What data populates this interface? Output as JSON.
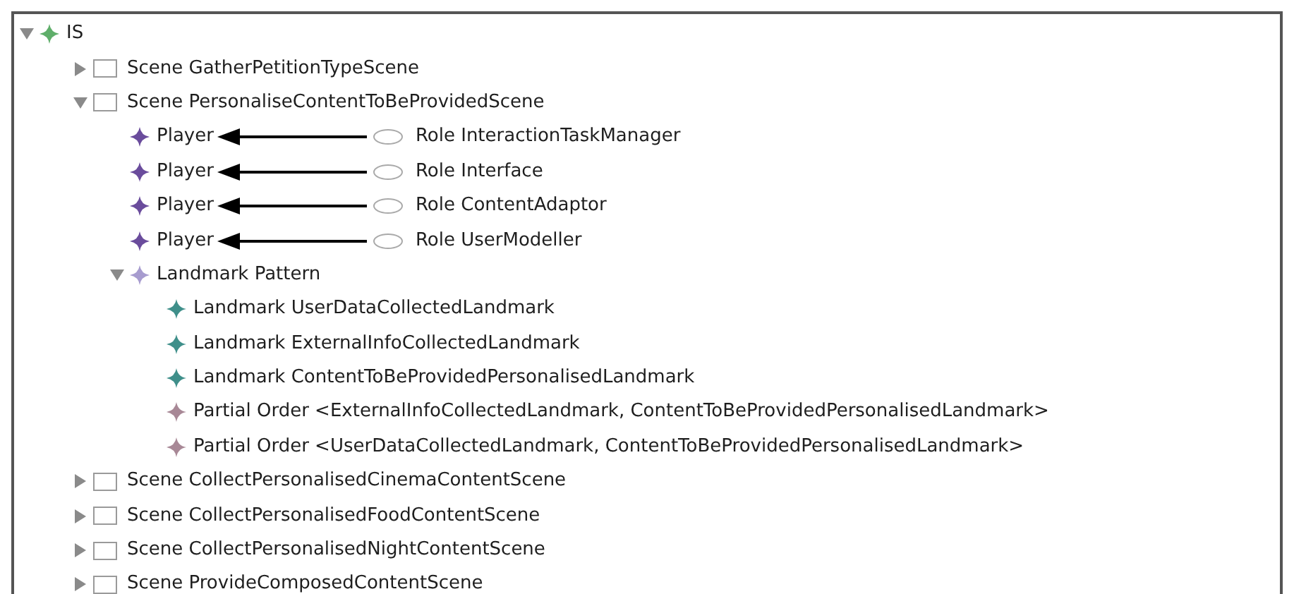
{
  "tree": {
    "label": "IS",
    "kind": "root",
    "expanded": true,
    "children": [
      {
        "label": "Scene GatherPetitionTypeScene",
        "kind": "scene",
        "expanded": false
      },
      {
        "label": "Scene PersonaliseContentToBeProvidedScene",
        "kind": "scene",
        "expanded": true,
        "children": [
          {
            "label": "Player",
            "kind": "player",
            "role": "Role InteractionTaskManager"
          },
          {
            "label": "Player",
            "kind": "player",
            "role": "Role Interface"
          },
          {
            "label": "Player",
            "kind": "player",
            "role": "Role ContentAdaptor"
          },
          {
            "label": "Player",
            "kind": "player",
            "role": "Role UserModeller"
          },
          {
            "label": "Landmark Pattern",
            "kind": "pattern",
            "expanded": true,
            "children": [
              {
                "label": "Landmark UserDataCollectedLandmark",
                "kind": "landmark"
              },
              {
                "label": "Landmark ExternalInfoCollectedLandmark",
                "kind": "landmark"
              },
              {
                "label": "Landmark ContentToBeProvidedPersonalisedLandmark",
                "kind": "landmark"
              },
              {
                "label": "Partial Order <ExternalInfoCollectedLandmark, ContentToBeProvidedPersonalisedLandmark>",
                "kind": "order"
              },
              {
                "label": "Partial Order <UserDataCollectedLandmark, ContentToBeProvidedPersonalisedLandmark>",
                "kind": "order"
              }
            ]
          }
        ]
      },
      {
        "label": "Scene CollectPersonalisedCinemaContentScene",
        "kind": "scene",
        "expanded": false
      },
      {
        "label": "Scene CollectPersonalisedFoodContentScene",
        "kind": "scene",
        "expanded": false
      },
      {
        "label": "Scene CollectPersonalisedNightContentScene",
        "kind": "scene",
        "expanded": false
      },
      {
        "label": "Scene ProvideComposedContentScene",
        "kind": "scene",
        "expanded": false
      }
    ]
  }
}
